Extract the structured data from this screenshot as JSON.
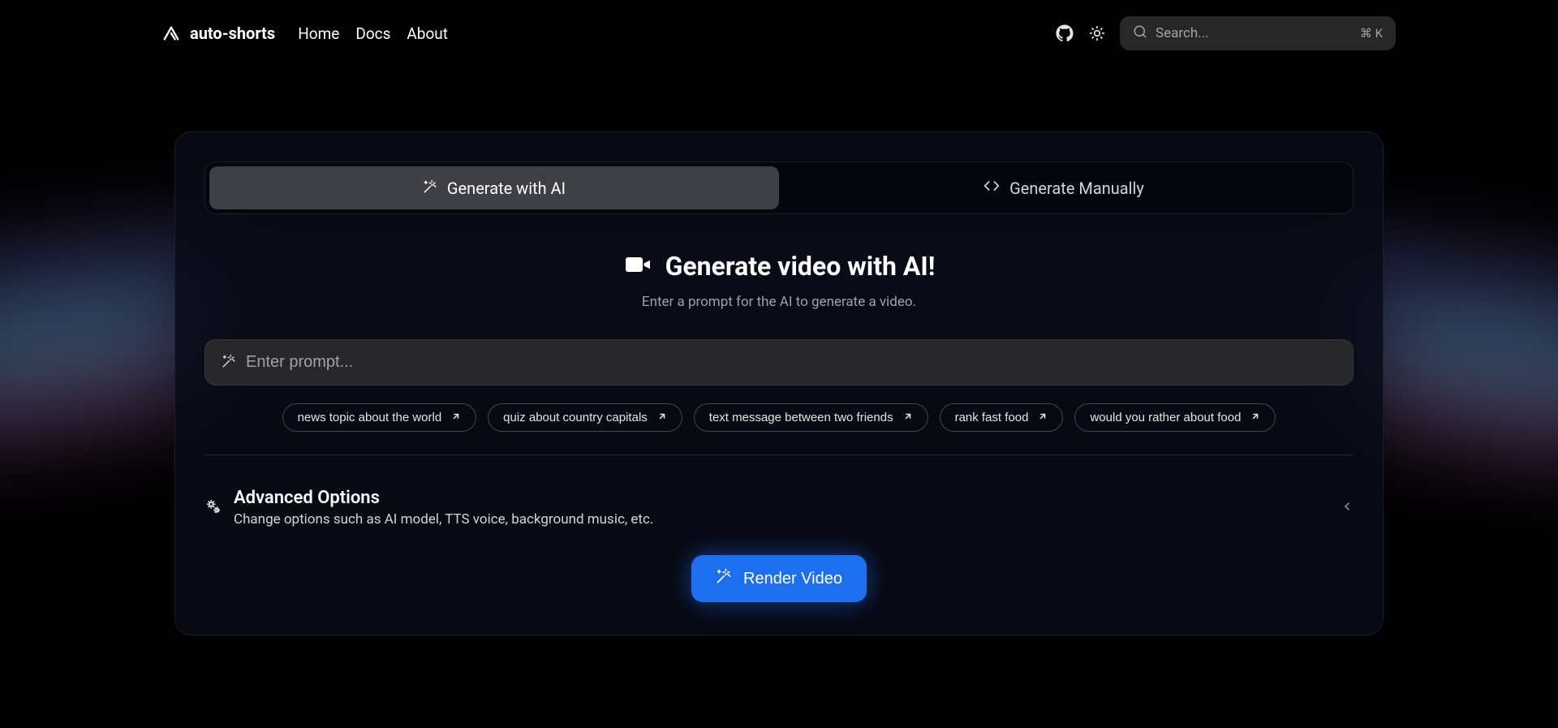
{
  "header": {
    "brand": "auto-shorts",
    "nav": [
      "Home",
      "Docs",
      "About"
    ],
    "search_placeholder": "Search...",
    "search_kbd": "⌘ K"
  },
  "tabs": {
    "ai_label": "Generate with AI",
    "manual_label": "Generate Manually"
  },
  "main": {
    "title": "Generate video with AI!",
    "subtitle": "Enter a prompt for the AI to generate a video.",
    "prompt_placeholder": "Enter prompt..."
  },
  "suggestions": [
    "news topic about the world",
    "quiz about country capitals",
    "text message between two friends",
    "rank fast food",
    "would you rather about food"
  ],
  "advanced": {
    "title": "Advanced Options",
    "desc": "Change options such as AI model, TTS voice, background music, etc."
  },
  "actions": {
    "render_label": "Render Video"
  }
}
